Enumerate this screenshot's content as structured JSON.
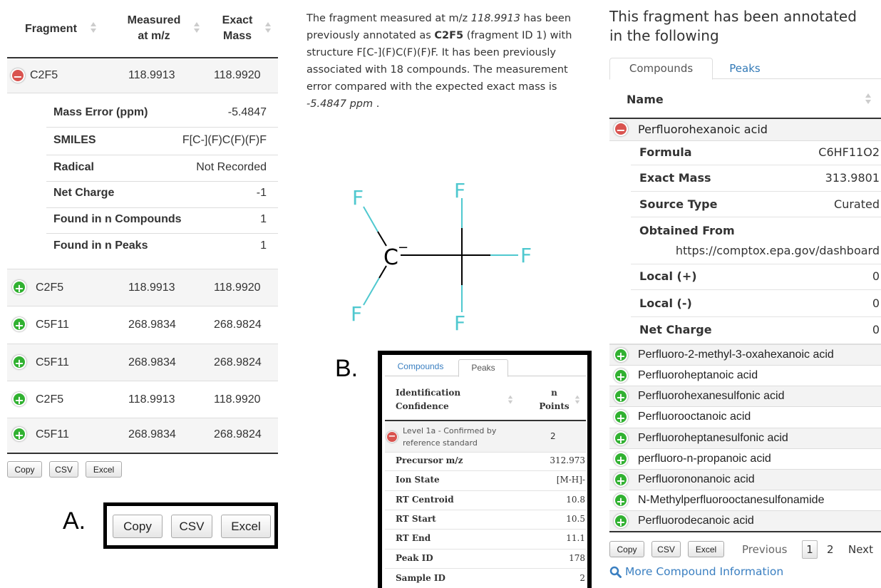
{
  "left_table": {
    "headers": [
      "Fragment",
      "Measured at m/z",
      "Exact Mass"
    ],
    "header_lines": {
      "measured": [
        "Measured",
        "at m/z"
      ],
      "exact": [
        "Exact",
        "Mass"
      ]
    },
    "expanded_row": {
      "fragment": "C2F5",
      "measured": "118.9913",
      "exact": "118.9920"
    },
    "details": [
      {
        "key": "Mass Error (ppm)",
        "value": "-5.4847"
      },
      {
        "key": "SMILES",
        "value": "F[C-](F)C(F)(F)F"
      },
      {
        "key": "Radical",
        "value": "Not Recorded"
      },
      {
        "key": "Net Charge",
        "value": "-1"
      },
      {
        "key": "Found in n Compounds",
        "value": "1"
      },
      {
        "key": "Found in n Peaks",
        "value": "1"
      }
    ],
    "rows": [
      {
        "fragment": "C2F5",
        "measured": "118.9913",
        "exact": "118.9920"
      },
      {
        "fragment": "C5F11",
        "measured": "268.9834",
        "exact": "268.9824"
      },
      {
        "fragment": "C5F11",
        "measured": "268.9834",
        "exact": "268.9824"
      },
      {
        "fragment": "C2F5",
        "measured": "118.9913",
        "exact": "118.9920"
      },
      {
        "fragment": "C5F11",
        "measured": "268.9834",
        "exact": "268.9824"
      }
    ],
    "buttons": [
      "Copy",
      "CSV",
      "Excel"
    ]
  },
  "panel_a": {
    "label": "A.",
    "buttons": [
      "Copy",
      "CSV",
      "Excel"
    ]
  },
  "description": {
    "p1": "The fragment measured at m/z ",
    "mz": "118.9913",
    "p2": " has been previously annotated as ",
    "formula": "C2F5",
    "p3": " (fragment ID 1) with structure F[C-](F)C(F)(F)F. It has been previously associated with 18 compounds. The measurement error compared with the expected exact mass is ",
    "ppm": "-5.4847 ppm",
    "p4": " ."
  },
  "structure": {
    "atoms": [
      "F",
      "F",
      "F",
      "F",
      "F",
      "C"
    ],
    "charge": "−",
    "colors": {
      "fluorine": "#4fc8cf",
      "bond": "#000000"
    }
  },
  "panel_b": {
    "label": "B.",
    "tabs": [
      "Compounds",
      "Peaks"
    ],
    "active_tab": "Peaks",
    "headers": {
      "ident": [
        "Identification",
        "Confidence"
      ],
      "points": [
        "n",
        "Points"
      ]
    },
    "row": {
      "level_lines": [
        "Level 1a - Confirmed by",
        "reference standard"
      ],
      "points": "2"
    },
    "details": [
      {
        "key": "Precursor m/z",
        "value": "312.973"
      },
      {
        "key": "Ion State",
        "value": "[M-H]-"
      },
      {
        "key": "RT Centroid",
        "value": "10.8"
      },
      {
        "key": "RT Start",
        "value": "10.5"
      },
      {
        "key": "RT End",
        "value": "11.1"
      },
      {
        "key": "Peak ID",
        "value": "178"
      },
      {
        "key": "Sample ID",
        "value": "2"
      }
    ]
  },
  "right_panel": {
    "heading_lines": [
      "This fragment has been annotated",
      "in the following"
    ],
    "tabs": [
      "Compounds",
      "Peaks"
    ],
    "active_tab": "Compounds",
    "column_header": "Name",
    "expanded": {
      "name": "Perfluorohexanoic acid"
    },
    "details": [
      {
        "key": "Formula",
        "value": "C6HF11O2"
      },
      {
        "key": "Exact Mass",
        "value": "313.9801"
      },
      {
        "key": "Source Type",
        "value": "Curated"
      },
      {
        "key": "Obtained From",
        "value": "https://comptox.epa.gov/dashboard"
      },
      {
        "key": "Local (+)",
        "value": "0"
      },
      {
        "key": "Local (-)",
        "value": "0"
      },
      {
        "key": "Net Charge",
        "value": "0"
      }
    ],
    "compounds": [
      "Perfluoro-2-methyl-3-oxahexanoic acid",
      "Perfluoroheptanoic acid",
      "Perfluorohexanesulfonic acid",
      "Perfluorooctanoic acid",
      "Perfluoroheptanesulfonic acid",
      "perfluoro-n-propanoic acid",
      "Perfluorononanoic acid",
      "N-Methylperfluorooctanesulfonamide",
      "Perfluorodecanoic acid"
    ],
    "buttons": [
      "Copy",
      "CSV",
      "Excel"
    ],
    "pagination": {
      "previous": "Previous",
      "pages": [
        "1",
        "2"
      ],
      "current": "1",
      "next": "Next"
    },
    "more_link": "More Compound Information",
    "colors": {
      "link": "#3a7fc1",
      "accent_tab": "#337ab7"
    }
  }
}
